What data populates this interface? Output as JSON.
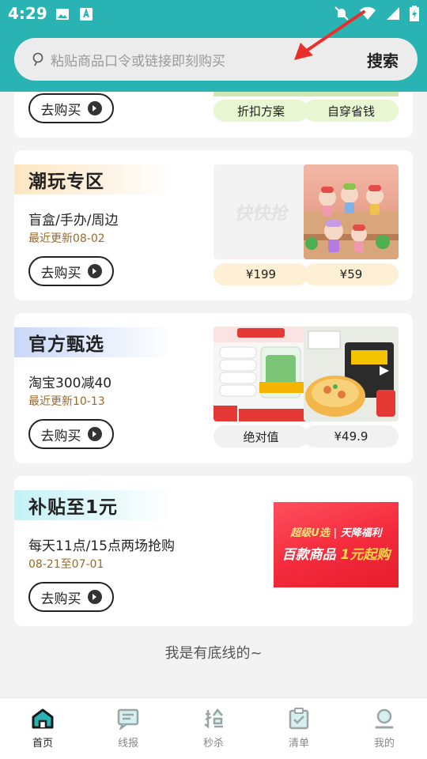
{
  "status": {
    "time": "4:29"
  },
  "search": {
    "placeholder": "粘贴商品口令或链接即刻购买",
    "button": "搜索"
  },
  "cards": [
    {
      "buy": "去购买",
      "pills": [
        "折扣方案",
        "自穿省钱"
      ]
    },
    {
      "title": "潮玩专区",
      "subtitle": "盲盒/手办/周边",
      "date": "最近更新08-02",
      "buy": "去购买",
      "placeholder_logo": "快快抢",
      "pills": [
        "¥199",
        "¥59"
      ]
    },
    {
      "title": "官方甄选",
      "subtitle": "淘宝300减40",
      "date": "最近更新10-13",
      "buy": "去购买",
      "pills": [
        "绝对值",
        "¥49.9"
      ]
    },
    {
      "title": "补贴至1元",
      "subtitle": "每天11点/15点两场抢购",
      "date": "08-21至07-01",
      "buy": "去购买",
      "banner": {
        "line1a": "超级U选",
        "line1b": "天降福利",
        "line2a": "百款商品",
        "line2b": "1元起购"
      }
    }
  ],
  "footer": "我是有底线的~",
  "nav": [
    {
      "label": "首页",
      "icon": "home-icon",
      "active": true
    },
    {
      "label": "线报",
      "icon": "message-icon",
      "active": false
    },
    {
      "label": "秒杀",
      "icon": "grab-icon",
      "active": false
    },
    {
      "label": "清单",
      "icon": "checklist-icon",
      "active": false
    },
    {
      "label": "我的",
      "icon": "profile-icon",
      "active": false
    }
  ],
  "colors": {
    "header": "#2ab3b3",
    "accent": "#222222",
    "date": "#9a6a2a"
  }
}
